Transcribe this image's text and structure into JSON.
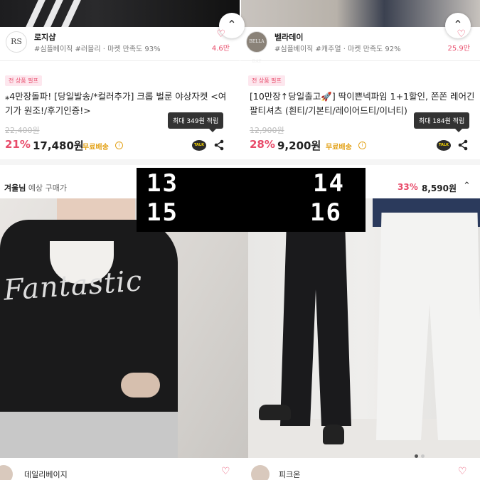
{
  "cards": [
    {
      "seller": {
        "logo_text": "RS",
        "name": "로지샵",
        "tags": "#심플베이직 #러블리 · 마켓 만족도 93%",
        "likes": "4.6만"
      },
      "badge": "전 상품 필프",
      "title": "⁎4만장돌파! [당일발송/*컬러추가] 크롭 벌룬 야상자켓 <여기가 원조!/후기인증!>",
      "old_price": "22,400원",
      "discount": "21%",
      "price": "17,480원",
      "shipping": "무료배송",
      "tooltip": "최대 349원 적립",
      "talk": "TALK"
    },
    {
      "seller": {
        "logo_text": "BELLA DAY",
        "name": "벨라데이",
        "tags": "#심플베이직 #캐주얼 · 마켓 만족도 92%",
        "likes": "25.9만"
      },
      "badge": "전 상품 필프",
      "title": "[10만장↑당일출고🚀] 딱이쁜넥파임 1+1할인, 쫀쫀 레어긴팔티셔츠 (흰티/기본티/레이어드티/이너티)",
      "old_price": "12,900원",
      "discount": "28%",
      "price": "9,200원",
      "shipping": "무료배송",
      "tooltip": "최대 184원 적립",
      "talk": "TALK"
    }
  ],
  "buyer_row": {
    "name": "겨울님",
    "suffix": " 예상 구매가",
    "discount": "33%",
    "price": "8,590원"
  },
  "overlay_numbers": [
    "13",
    "14",
    "15",
    "16"
  ],
  "bottom_sellers": [
    {
      "name": "데일리베이지"
    },
    {
      "name": "피크온"
    }
  ],
  "icons": {
    "heart": "♡",
    "chevron_up": "⌃",
    "info": "i"
  },
  "colors": {
    "accent": "#e84b6a",
    "shipping": "#e3a31b"
  }
}
